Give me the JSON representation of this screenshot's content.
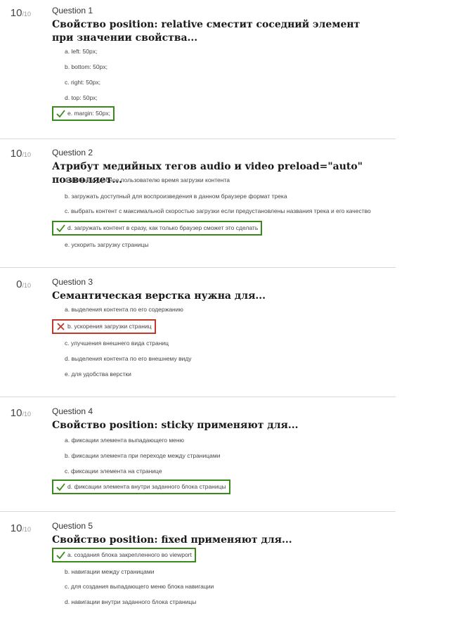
{
  "score_outof": "/10",
  "questions": [
    {
      "number": "Question 1",
      "score": "10",
      "title": "Свойство position: relative сместит соседний элемент при значении свойства...",
      "answers": [
        {
          "text": "a. left: 50px;",
          "state": "none"
        },
        {
          "text": "b. bottom: 50px;",
          "state": "none"
        },
        {
          "text": "c. right: 50px;",
          "state": "none"
        },
        {
          "text": "d. top: 50px;",
          "state": "none"
        },
        {
          "text": "e. margin: 50px;",
          "state": "correct"
        }
      ]
    },
    {
      "number": "Question 2",
      "score": "10",
      "title": "Атрибут медийных тегов audio и video preload=\"auto\" позволяет...",
      "answers": [
        {
          "text": "a. выбрать удобное пользователю время загрузки контента",
          "state": "none"
        },
        {
          "text": "b. загружать доступный для воспроизведения в данном браузере формат трека",
          "state": "none"
        },
        {
          "text": "c. выбрать контент с максимальной скоростью загрузки если предустановлены названия трека и его качество",
          "state": "none"
        },
        {
          "text": "d. загружать контент в сразу, как только браузер сможет это сделать",
          "state": "correct"
        },
        {
          "text": "e. ускорить загрузку страницы",
          "state": "none"
        }
      ]
    },
    {
      "number": "Question 3",
      "score": "0",
      "title": "Семантическая верстка нужна для...",
      "answers": [
        {
          "text": "a. выделения контента по его содержанию",
          "state": "none"
        },
        {
          "text": "b. ускорения загрузки страниц",
          "state": "wrong"
        },
        {
          "text": "c. улучшения внешнего вида страниц",
          "state": "none"
        },
        {
          "text": "d. выделения контента по его внешнему виду",
          "state": "none"
        },
        {
          "text": "e. для удобства верстки",
          "state": "none"
        }
      ]
    },
    {
      "number": "Question 4",
      "score": "10",
      "title": "Свойство position: sticky применяют для...",
      "answers": [
        {
          "text": "a. фиксации элемента выпадающего меню",
          "state": "none"
        },
        {
          "text": "b. фиксации элемента при переходе между страницами",
          "state": "none"
        },
        {
          "text": "c. фиксации элемента на странице",
          "state": "none"
        },
        {
          "text": "d. фиксации элемента внутри заданного блока страницы",
          "state": "correct"
        }
      ]
    },
    {
      "number": "Question 5",
      "score": "10",
      "title": "Свойство position: fixed применяют для...",
      "answers": [
        {
          "text": "a. создания блока закрепленного во viewport",
          "state": "correct"
        },
        {
          "text": "b. навигации между страницами",
          "state": "none"
        },
        {
          "text": "c. для создания выпадающего меню блока навигации",
          "state": "none"
        },
        {
          "text": "d. навигации внутри заданного блока страницы",
          "state": "none"
        }
      ]
    }
  ],
  "colors": {
    "correct": "#3a8a1a",
    "wrong": "#c0392b"
  },
  "icons": {
    "correct": "checkmark-icon",
    "wrong": "cross-icon"
  }
}
